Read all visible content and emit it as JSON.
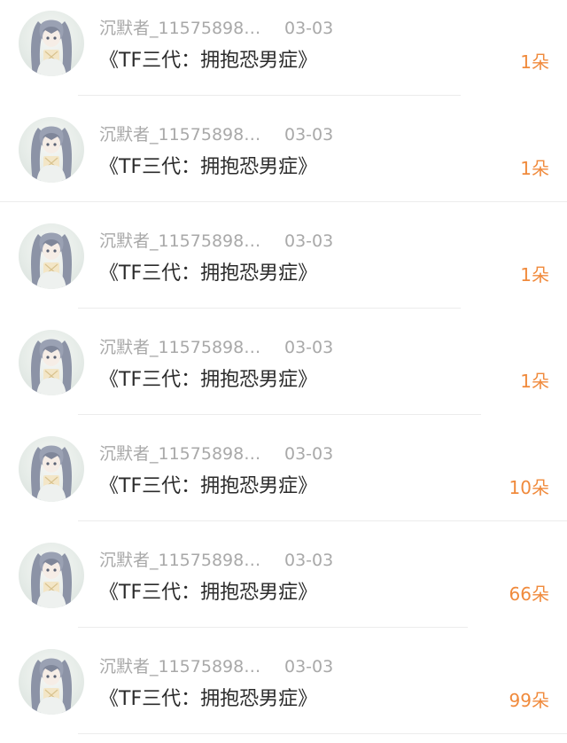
{
  "colors": {
    "meta_text": "#a9a9a9",
    "title_text": "#2b2b2b",
    "gift_accent": "#f08a3c",
    "divider": "#ececec",
    "background": "#ffffff"
  },
  "items": [
    {
      "username": "沉默者_11575898…",
      "date": "03-03",
      "title": "《TF三代：拥抱恐男症》",
      "gift": "1朵",
      "avatar_icon": "anime-girl-avatar-icon"
    },
    {
      "username": "沉默者_11575898…",
      "date": "03-03",
      "title": "《TF三代：拥抱恐男症》",
      "gift": "1朵",
      "avatar_icon": "anime-girl-avatar-icon"
    },
    {
      "username": "沉默者_11575898…",
      "date": "03-03",
      "title": "《TF三代：拥抱恐男症》",
      "gift": "1朵",
      "avatar_icon": "anime-girl-avatar-icon"
    },
    {
      "username": "沉默者_11575898…",
      "date": "03-03",
      "title": "《TF三代：拥抱恐男症》",
      "gift": "1朵",
      "avatar_icon": "anime-girl-avatar-icon"
    },
    {
      "username": "沉默者_11575898…",
      "date": "03-03",
      "title": "《TF三代：拥抱恐男症》",
      "gift": "10朵",
      "avatar_icon": "anime-girl-avatar-icon"
    },
    {
      "username": "沉默者_11575898…",
      "date": "03-03",
      "title": "《TF三代：拥抱恐男症》",
      "gift": "66朵",
      "avatar_icon": "anime-girl-avatar-icon"
    },
    {
      "username": "沉默者_11575898…",
      "date": "03-03",
      "title": "《TF三代：拥抱恐男症》",
      "gift": "99朵",
      "avatar_icon": "anime-girl-avatar-icon"
    }
  ]
}
